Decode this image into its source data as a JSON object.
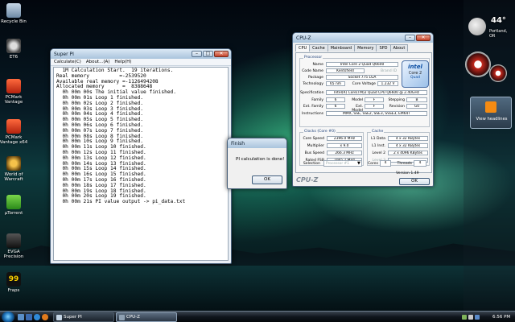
{
  "desktop": {
    "icons": [
      {
        "label": "Recycle Bin"
      },
      {
        "label": "ET6"
      },
      {
        "label": "PCMark Vantage"
      },
      {
        "label": "PCMark Vantage x64"
      },
      {
        "label": "World of Warcraft"
      },
      {
        "label": "µTorrent"
      },
      {
        "label": "EVGA Precision"
      },
      {
        "label": "Fraps"
      }
    ]
  },
  "superpi": {
    "title": "Super PI",
    "menu": [
      "Calculate(C)",
      "About...(A)",
      "Help(H)"
    ],
    "lines": [
      "  1M Calculation Start.  19 iterations.",
      "Real memory          =-2539520",
      "Available real memory =-1126494208",
      "Allocated memory      =  8388648",
      "  0h 00m 00s The initial value finished.",
      "  0h 00m 01s Loop 1 finished.",
      "  0h 00m 02s Loop 2 finished.",
      "  0h 00m 03s Loop 3 finished.",
      "  0h 00m 04s Loop 4 finished.",
      "  0h 00m 05s Loop 5 finished.",
      "  0h 00m 06s Loop 6 finished.",
      "  0h 00m 07s Loop 7 finished.",
      "  0h 00m 08s Loop 8 finished.",
      "  0h 00m 10s Loop 9 finished.",
      "  0h 00m 11s Loop 10 finished.",
      "  0h 00m 12s Loop 11 finished.",
      "  0h 00m 13s Loop 12 finished.",
      "  0h 00m 14s Loop 13 finished.",
      "  0h 00m 15s Loop 14 finished.",
      "  0h 00m 16s Loop 15 finished.",
      "  0h 00m 17s Loop 16 finished.",
      "  0h 00m 18s Loop 17 finished.",
      "  0h 00m 19s Loop 18 finished.",
      "  0h 00m 20s Loop 19 finished.",
      "  0h 00m 21s PI value output -> pi_data.txt"
    ]
  },
  "finish": {
    "title": "Finish",
    "message": "PI calculation is done!",
    "ok": "OK"
  },
  "cpuz": {
    "title": "CPU-Z",
    "tabs": [
      "CPU",
      "Cache",
      "Mainboard",
      "Memory",
      "SPD",
      "About"
    ],
    "processor": {
      "group": "Processor",
      "name_label": "Name",
      "name": "Intel Core 2 Quad Q6600",
      "codename_label": "Code Name",
      "codename": "Kentsfield",
      "brand": "Brand ID",
      "package_label": "Package",
      "package": "Socket 775 LGA",
      "technology_label": "Technology",
      "technology": "65 nm",
      "voltage_label": "Core Voltage",
      "voltage": "1.232 V",
      "spec_label": "Specification",
      "spec": "Intel(R) Core(TM)2 Quad CPU   Q6600 @ 2.40GHz",
      "family_label": "Family",
      "family": "6",
      "model_label": "Model",
      "model": "F",
      "stepping_label": "Stepping",
      "stepping": "B",
      "extfamily_label": "Ext. Family",
      "extfamily": "6",
      "extmodel_label": "Ext. Model",
      "extmodel": "F",
      "revision_label": "Revision",
      "revision": "G0",
      "instr_label": "Instructions",
      "instr": "MMX, SSE, SSE2, SSE3, SSSE3, EM64T"
    },
    "logo": {
      "brand": "intel",
      "line1": "Core 2",
      "line2": "Quad"
    },
    "clocks": {
      "group": "Clocks (Core #0)",
      "corespeed_label": "Core Speed",
      "corespeed": "2396.0 MHz",
      "multiplier_label": "Multiplier",
      "multiplier": "x 9.0",
      "busspeed_label": "Bus Speed",
      "busspeed": "266.3 MHz",
      "ratedfsb_label": "Rated FSB",
      "ratedfsb": "1065.2 MHz"
    },
    "cache": {
      "group": "Cache",
      "l1d_label": "L1 Data",
      "l1d": "4 x 32 KBytes",
      "l1i_label": "L1 Inst.",
      "l1i": "4 x 32 KBytes",
      "l2_label": "Level 2",
      "l2": "2 x 4096 KBytes",
      "l3_label": "Level 3",
      "l3": ""
    },
    "selection_label": "Selection",
    "selection": "Processor #1",
    "cores_label": "Cores",
    "cores": "4",
    "threads_label": "Threads",
    "threads": "4",
    "version": "Version 1.49",
    "footer_logo": "CPU-Z",
    "ok": "OK"
  },
  "gadgets": {
    "weather_temp": "44°",
    "weather_city": "Portland, OR",
    "rss_label": "View headlines"
  },
  "taskbar": {
    "tasks": [
      {
        "label": "Super PI"
      },
      {
        "label": "CPU-Z"
      }
    ],
    "clock": "6:56 PM"
  }
}
